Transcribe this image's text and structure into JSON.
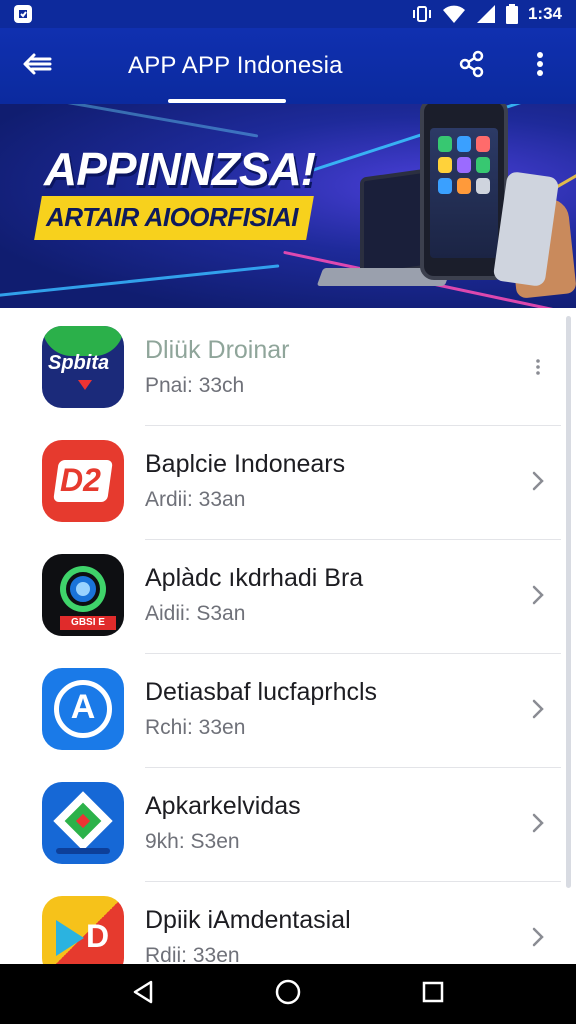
{
  "status_bar": {
    "time": "1:34",
    "icons": [
      "notification-icon",
      "vibrate-icon",
      "wifi-icon",
      "signal-icon",
      "battery-icon"
    ]
  },
  "app_bar": {
    "title": "APP APP Indonesia",
    "icons": [
      "back-arrow-icon",
      "share-icon",
      "more-vert-icon"
    ]
  },
  "banner": {
    "headline": "APPINNZSA!",
    "tagline": "ARTAIR AIOORFISIAI",
    "colors": {
      "background": "#1e2a9a",
      "tag": "#f7d11d",
      "headline": "#ffffff"
    }
  },
  "list": {
    "items": [
      {
        "title": "Dliük Droinar",
        "subtitle": "Pnai: 33ch",
        "icon": "sports-app-icon",
        "icon_text": "Spbita",
        "action_icon": "drag-handle-icon"
      },
      {
        "title": "Baplcie Indonears",
        "subtitle": "Ardii: 33an",
        "icon": "d2-app-icon",
        "icon_text": "D2",
        "action_icon": "chevron-right-icon"
      },
      {
        "title": "Aplàdc ıkdrhadi Bra",
        "subtitle": "Aidii: S3an",
        "icon": "camera-app-icon",
        "icon_text": "GBSI E",
        "action_icon": "chevron-right-icon"
      },
      {
        "title": "Detiasbaf lucfaprhcls",
        "subtitle": "Rchi: 33en",
        "icon": "a-logo-app-icon",
        "icon_text": "A",
        "action_icon": "chevron-right-icon"
      },
      {
        "title": "Apkarkelvidas",
        "subtitle": "9kh: S3en",
        "icon": "gem-app-icon",
        "icon_text": "",
        "action_icon": "chevron-right-icon"
      },
      {
        "title": "Dpiik iAmdentasial",
        "subtitle": "Rdii: 33en",
        "icon": "play-d-app-icon",
        "icon_text": "D",
        "action_icon": "chevron-right-icon"
      }
    ]
  },
  "nav_bar": {
    "icons": [
      "back-triangle-icon",
      "home-circle-icon",
      "recents-square-icon"
    ]
  },
  "colors": {
    "primary": "#0d2a9c",
    "divider": "#e3e4e8",
    "subtitle": "#6f7179"
  }
}
